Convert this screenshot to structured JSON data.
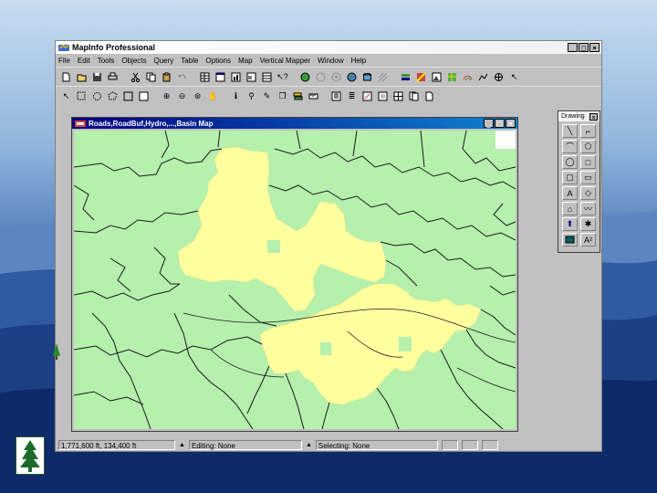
{
  "app": {
    "title": "MapInfo Professional",
    "window_buttons": [
      "_",
      "□",
      "×"
    ]
  },
  "menu": [
    "File",
    "Edit",
    "Tools",
    "Objects",
    "Query",
    "Table",
    "Options",
    "Map",
    "Vertical Mapper",
    "Window",
    "Help"
  ],
  "map_window": {
    "title": "Roads,RoadBuf,Hydro,...,Basin Map",
    "window_buttons": [
      "_",
      "□",
      "×"
    ],
    "colors": {
      "background": "#b5f0ad",
      "basin": "#ffffa0",
      "lines": "#1a1a1a"
    }
  },
  "drawing_palette": {
    "title": "Drawing",
    "close": "×",
    "tools": [
      "line-icon",
      "polyline-icon",
      "arc-icon",
      "polygon-icon",
      "ellipse-icon",
      "rectangle-icon",
      "rounded-rect-icon",
      "text-icon",
      "frame-icon",
      "reshape-icon",
      "add-node-icon",
      "line-style-icon",
      "region-style-icon",
      "text-style-icon",
      "symbol-icon",
      "symbol-style-icon"
    ],
    "text_tool_label": "A",
    "text_style_label": "A²"
  },
  "status": {
    "coords": "1,771,600 ft, 134,400 ft",
    "editing": "Editing: None",
    "selecting": "Selecting: None"
  }
}
